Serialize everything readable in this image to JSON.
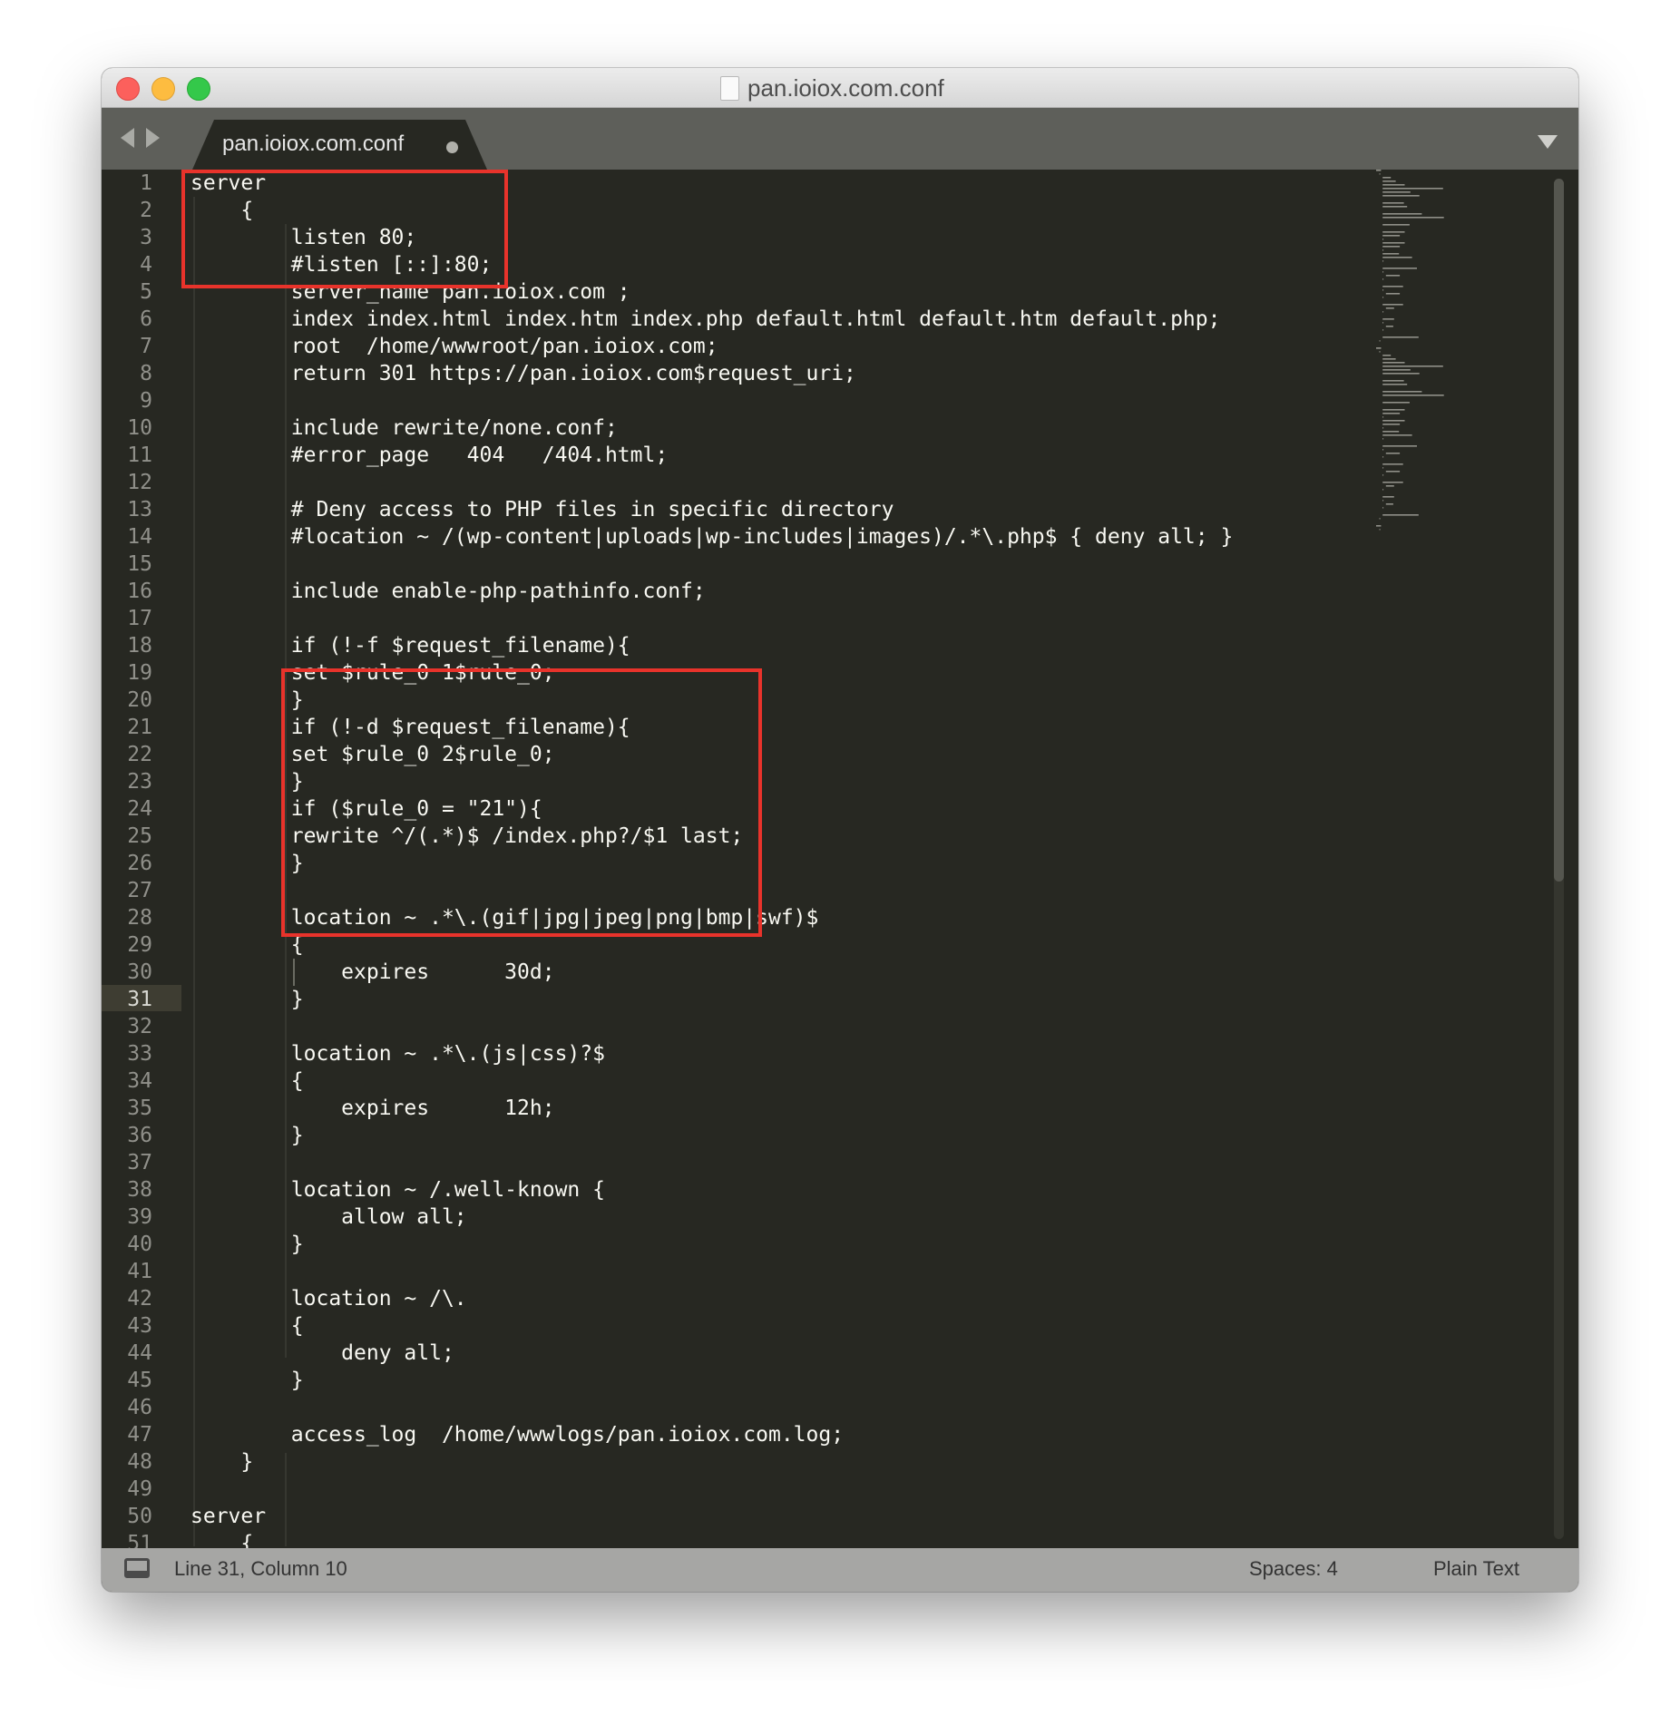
{
  "window": {
    "title": "pan.ioiox.com.conf"
  },
  "tab": {
    "label": "pan.ioiox.com.conf"
  },
  "editor": {
    "line_numbers": [
      "1",
      "2",
      "3",
      "4",
      "5",
      "6",
      "7",
      "8",
      "9",
      "10",
      "11",
      "12",
      "13",
      "14",
      "15",
      "16",
      "17",
      "18",
      "19",
      "20",
      "21",
      "22",
      "23",
      "24",
      "25",
      "26",
      "27",
      "28",
      "29",
      "30",
      "31",
      "32",
      "33",
      "34",
      "35",
      "36",
      "37",
      "38",
      "39",
      "40",
      "41",
      "42",
      "43",
      "44",
      "45",
      "46",
      "47",
      "48",
      "49",
      "50",
      "51"
    ],
    "current_line": 31,
    "lines": [
      "server",
      "    {",
      "        listen 80;",
      "        #listen [::]:80;",
      "        server_name pan.ioiox.com ;",
      "        index index.html index.htm index.php default.html default.htm default.php;",
      "        root  /home/wwwroot/pan.ioiox.com;",
      "        return 301 https://pan.ioiox.com$request_uri;",
      "",
      "        include rewrite/none.conf;",
      "        #error_page   404   /404.html;",
      "",
      "        # Deny access to PHP files in specific directory",
      "        #location ~ /(wp-content|uploads|wp-includes|images)/.*\\.php$ { deny all; }",
      "",
      "        include enable-php-pathinfo.conf;",
      "",
      "        if (!-f $request_filename){",
      "        set $rule_0 1$rule_0;",
      "        }",
      "        if (!-d $request_filename){",
      "        set $rule_0 2$rule_0;",
      "        }",
      "        if ($rule_0 = \"21\"){",
      "        rewrite ^/(.*)$ /index.php?/$1 last;",
      "        }",
      "",
      "        location ~ .*\\.(gif|jpg|jpeg|png|bmp|swf)$",
      "        {",
      "            expires      30d;",
      "        }",
      "",
      "        location ~ .*\\.(js|css)?$",
      "        {",
      "            expires      12h;",
      "        }",
      "",
      "        location ~ /.well-known {",
      "            allow all;",
      "        }",
      "",
      "        location ~ /\\.",
      "        {",
      "            deny all;",
      "        }",
      "",
      "        access_log  /home/wwwlogs/pan.ioiox.com.log;",
      "    }",
      "",
      "server",
      "    {"
    ]
  },
  "status": {
    "position": "Line 31, Column 10",
    "indentation": "Spaces: 4",
    "syntax": "Plain Text"
  },
  "colors": {
    "editor_background": "#272822",
    "gutter_text": "#90908a",
    "code_text": "#f8f8f2",
    "annotation_box": "#e8332b",
    "tabbar": "#5e5f5a",
    "statusbar": "#a6a6a4"
  },
  "icons": {
    "close": "close-button",
    "minimize": "minimize-button",
    "zoom": "zoom-button",
    "document": "document-icon",
    "back": "chevron-left-icon",
    "forward": "chevron-right-icon",
    "dirty": "unsaved-dot-icon",
    "tab_menu": "chevron-down-icon",
    "panel": "panel-toggle-icon"
  }
}
